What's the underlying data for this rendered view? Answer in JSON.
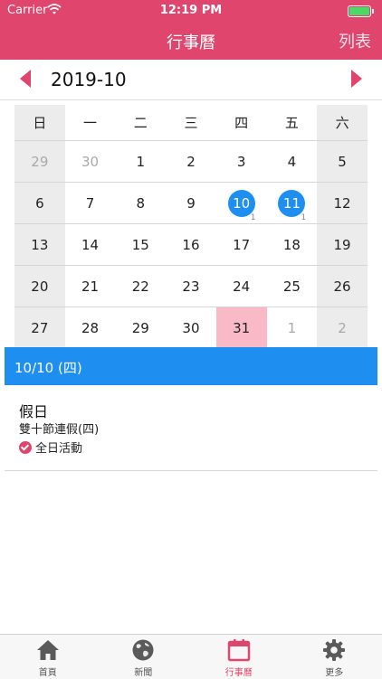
{
  "status_bar": {
    "carrier": "Carrier",
    "time": "12:19 PM"
  },
  "nav": {
    "title": "行事曆",
    "right_label": "列表"
  },
  "calendar": {
    "month_label": "2019-10",
    "weekdays": [
      "日",
      "一",
      "二",
      "三",
      "四",
      "五",
      "六"
    ],
    "weeks": [
      [
        {
          "day": "29",
          "muted": true
        },
        {
          "day": "30",
          "muted": true
        },
        {
          "day": "1"
        },
        {
          "day": "2"
        },
        {
          "day": "3"
        },
        {
          "day": "4"
        },
        {
          "day": "5"
        }
      ],
      [
        {
          "day": "6"
        },
        {
          "day": "7"
        },
        {
          "day": "8"
        },
        {
          "day": "9"
        },
        {
          "day": "10",
          "marked": true,
          "count": "1"
        },
        {
          "day": "11",
          "marked": true,
          "count": "1"
        },
        {
          "day": "12"
        }
      ],
      [
        {
          "day": "13"
        },
        {
          "day": "14"
        },
        {
          "day": "15"
        },
        {
          "day": "16"
        },
        {
          "day": "17"
        },
        {
          "day": "18"
        },
        {
          "day": "19"
        }
      ],
      [
        {
          "day": "20"
        },
        {
          "day": "21"
        },
        {
          "day": "22"
        },
        {
          "day": "23"
        },
        {
          "day": "24"
        },
        {
          "day": "25"
        },
        {
          "day": "26"
        }
      ],
      [
        {
          "day": "27"
        },
        {
          "day": "28"
        },
        {
          "day": "29"
        },
        {
          "day": "30"
        },
        {
          "day": "31",
          "today": true
        },
        {
          "day": "1",
          "muted": true
        },
        {
          "day": "2",
          "muted": true
        }
      ]
    ]
  },
  "selected_date": {
    "label": "10/10 (四)"
  },
  "event": {
    "title": "假日",
    "subtitle": "雙十節連假(四)",
    "all_day_label": "全日活動"
  },
  "tabs": [
    {
      "label": "首頁",
      "icon": "home-icon",
      "active": false
    },
    {
      "label": "新聞",
      "icon": "globe-icon",
      "active": false
    },
    {
      "label": "行事曆",
      "icon": "calendar-icon",
      "active": true
    },
    {
      "label": "更多",
      "icon": "gear-icon",
      "active": false
    }
  ],
  "colors": {
    "accent": "#e0456e",
    "selection_blue": "#1e8ff0",
    "today_pink": "#f9b9c6",
    "weekend_gray": "#ececec"
  }
}
